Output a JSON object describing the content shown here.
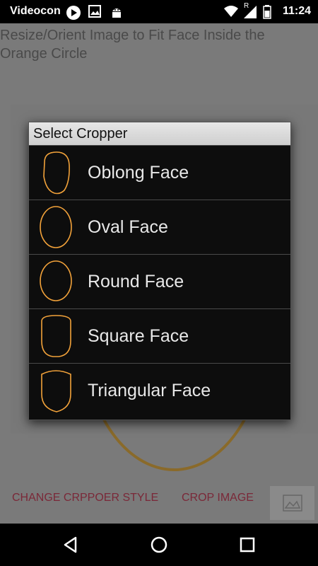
{
  "status_bar": {
    "carrier": "Videocon",
    "time": "11:24",
    "signal_label": "R"
  },
  "app": {
    "instructions": "Resize/Orient Image to Fit Face Inside the Orange Circle",
    "actions": {
      "change_style": "CHANGE CRPPOER STYLE",
      "crop_image": "CROP IMAGE"
    }
  },
  "dialog": {
    "title": "Select Cropper",
    "options": [
      {
        "label": "Oblong Face",
        "icon": "oblong-face-icon"
      },
      {
        "label": "Oval Face",
        "icon": "oval-face-icon"
      },
      {
        "label": "Round Face",
        "icon": "round-face-icon"
      },
      {
        "label": "Square Face",
        "icon": "square-face-icon"
      },
      {
        "label": "Triangular Face",
        "icon": "triangular-face-icon"
      }
    ]
  },
  "colors": {
    "face_outline": "#f2a23a",
    "action_text": "#7a2838"
  }
}
